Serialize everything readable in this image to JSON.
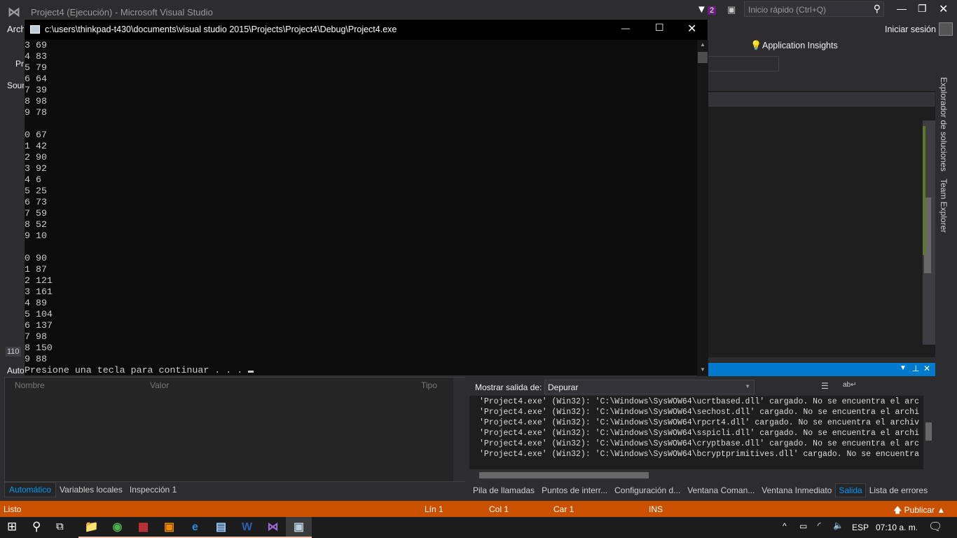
{
  "vs": {
    "title": "Project4 (Ejecución) - Microsoft Visual Studio",
    "notifications_count": "2",
    "quick_launch_placeholder": "Inicio rápido (Ctrl+Q)",
    "sign_in": "Iniciar sesión",
    "menu_partial": "Arch",
    "toolbar_partial": "Pr",
    "panel_partial": "Sour",
    "app_insights": "Application Insights",
    "zoom_level": "110",
    "side_tabs": [
      "Explorador de soluciones",
      "Team Explorer"
    ]
  },
  "console": {
    "title": "c:\\users\\thinkpad-t430\\documents\\visual studio 2015\\Projects\\Project4\\Debug\\Project4.exe",
    "lines": [
      "3 69",
      "4 83",
      "5 79",
      "6 64",
      "7 39",
      "8 98",
      "9 78",
      "",
      "0 67",
      "1 42",
      "2 90",
      "3 92",
      "4 6",
      "5 25",
      "6 73",
      "7 59",
      "8 52",
      "9 10",
      "",
      "0 90",
      "1 87",
      "2 121",
      "3 161",
      "4 89",
      "5 104",
      "6 137",
      "7 98",
      "8 150",
      "9 88",
      "Presione una tecla para continuar . . . "
    ]
  },
  "autos": {
    "title_partial": "Auto",
    "columns": [
      "Nombre",
      "Valor",
      "Tipo"
    ],
    "tabs": [
      "Automático",
      "Variables locales",
      "Inspección 1"
    ],
    "active_tab": "Automático"
  },
  "output": {
    "show_from_label": "Mostrar salida de:",
    "source": "Depurar",
    "lines": [
      "'Project4.exe' (Win32): 'C:\\Windows\\SysWOW64\\ucrtbased.dll' cargado. No se encuentra el arc",
      "'Project4.exe' (Win32): 'C:\\Windows\\SysWOW64\\sechost.dll' cargado. No se encuentra el archi",
      "'Project4.exe' (Win32): 'C:\\Windows\\SysWOW64\\rpcrt4.dll' cargado. No se encuentra el archiv",
      "'Project4.exe' (Win32): 'C:\\Windows\\SysWOW64\\sspicli.dll' cargado. No se encuentra el archi",
      "'Project4.exe' (Win32): 'C:\\Windows\\SysWOW64\\cryptbase.dll' cargado. No se encuentra el arc",
      "'Project4.exe' (Win32): 'C:\\Windows\\SysWOW64\\bcryptprimitives.dll' cargado. No se encuentra"
    ],
    "tabs": [
      "Pila de llamadas",
      "Puntos de interr...",
      "Configuración d...",
      "Ventana Coman...",
      "Ventana Inmediato",
      "Salida",
      "Lista de errores"
    ],
    "active_tab": "Salida"
  },
  "status": {
    "state": "Listo",
    "line": "Lín 1",
    "col": "Col 1",
    "char": "Car 1",
    "mode": "INS",
    "publish": "Publicar"
  },
  "taskbar": {
    "language": "ESP",
    "time": "07:10 a. m.",
    "apps": [
      "file-explorer",
      "chrome",
      "app-2018",
      "app-fm",
      "edge",
      "notepad",
      "word",
      "visual-studio",
      "console"
    ]
  },
  "colors": {
    "accent": "#007acc",
    "status_bar": "#ca5100",
    "console_bg": "#0c0c0c"
  }
}
